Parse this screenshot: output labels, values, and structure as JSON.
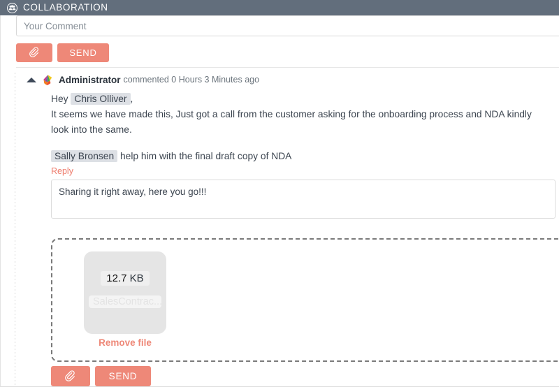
{
  "header": {
    "title": "COLLABORATION",
    "icon": "users-group-icon",
    "background": "#626e7c",
    "text_color": "#ffffff"
  },
  "theme": {
    "accent": "#ee8878",
    "accent_text": "#ee7a6a",
    "mention_bg": "#dde0e5",
    "body_text": "#3c4550",
    "meta_text": "#6c757d"
  },
  "composer": {
    "input_placeholder": "Your Comment",
    "input_value": "",
    "attach_icon": "paperclip-icon",
    "attach_label": "",
    "send_label": "SEND"
  },
  "comment": {
    "collapse_icon": "caret-up-icon",
    "avatar": "rainbow-logo-avatar",
    "author": "Administrator",
    "meta": "commented 0 Hours 3 Minutes ago",
    "greeting_prefix": "Hey",
    "mention_1": "Chris Olliver",
    "greeting_suffix": ",",
    "paragraph": "It seems we have made this, Just got a call from the customer asking for the onboarding process and NDA kindly look into the same.",
    "mention_2": "Sally Bronsen",
    "second_line": "help him with the final draft copy of NDA",
    "reply_label": "Reply",
    "reply_value": "Sharing it right away, here you go!!!",
    "reply_placeholder": ""
  },
  "dropzone": {
    "file": {
      "size": "12.7",
      "size_unit": "KB",
      "name": "SalesContrac...",
      "remove_label": "Remove file"
    }
  },
  "bottom_actions": {
    "attach_icon": "paperclip-icon",
    "attach_label": "",
    "send_label": "SEND"
  }
}
